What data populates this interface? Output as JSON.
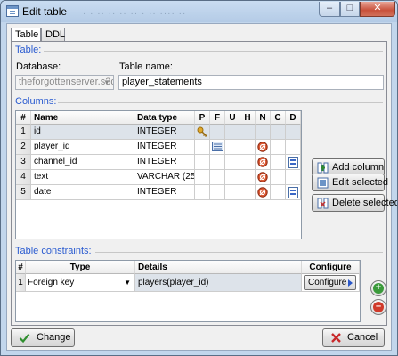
{
  "window": {
    "title": "Edit table",
    "ghost_text": "· ·  ·· ··  ·· ·· ·  ·· ···· ··",
    "min_glyph": "–",
    "max_glyph": "□",
    "close_glyph": "✕"
  },
  "tabs": [
    {
      "label": "Table",
      "active": true
    },
    {
      "label": "DDL",
      "active": false
    }
  ],
  "table_section": {
    "heading": "Table:",
    "database_label": "Database:",
    "database_value": "theforgottenserver.s3d",
    "table_name_label": "Table name:",
    "table_name_value": "player_statements"
  },
  "columns_section": {
    "heading": "Columns:",
    "headers": [
      "#",
      "Name",
      "Data type",
      "P",
      "F",
      "U",
      "H",
      "N",
      "C",
      "D"
    ],
    "rows": [
      {
        "num": "1",
        "name": "id",
        "type": "INTEGER",
        "P": "key-icon",
        "F": "",
        "U": "",
        "H": "",
        "N": "",
        "C": "",
        "D": "",
        "selected": true
      },
      {
        "num": "2",
        "name": "player_id",
        "type": "INTEGER",
        "P": "",
        "F": "fk-icon",
        "U": "",
        "H": "",
        "N": "not-null-icon",
        "C": "",
        "D": "",
        "selected": false
      },
      {
        "num": "3",
        "name": "channel_id",
        "type": "INTEGER",
        "P": "",
        "F": "",
        "U": "",
        "H": "",
        "N": "not-null-icon",
        "C": "",
        "D": "default-icon",
        "selected": false
      },
      {
        "num": "4",
        "name": "text",
        "type": "VARCHAR (255)",
        "P": "",
        "F": "",
        "U": "",
        "H": "",
        "N": "not-null-icon",
        "C": "",
        "D": "",
        "selected": false
      },
      {
        "num": "5",
        "name": "date",
        "type": "INTEGER",
        "P": "",
        "F": "",
        "U": "",
        "H": "",
        "N": "not-null-icon",
        "C": "",
        "D": "default-icon",
        "selected": false
      }
    ],
    "buttons": {
      "add_column": "Add column",
      "edit_selected": "Edit selected",
      "delete_selected": "Delete selected"
    }
  },
  "constraints_section": {
    "heading": "Table constraints:",
    "headers": [
      "#",
      "Type",
      "Details",
      "Configure"
    ],
    "rows": [
      {
        "num": "1",
        "type": "Foreign key",
        "details": "players(player_id)",
        "configure": "Configure"
      }
    ]
  },
  "footer": {
    "change": "Change",
    "cancel": "Cancel"
  },
  "colors": {
    "accent": "#2a5bd0",
    "selected_row": "#dde3ea",
    "window_frame": "#c2d6ec"
  }
}
